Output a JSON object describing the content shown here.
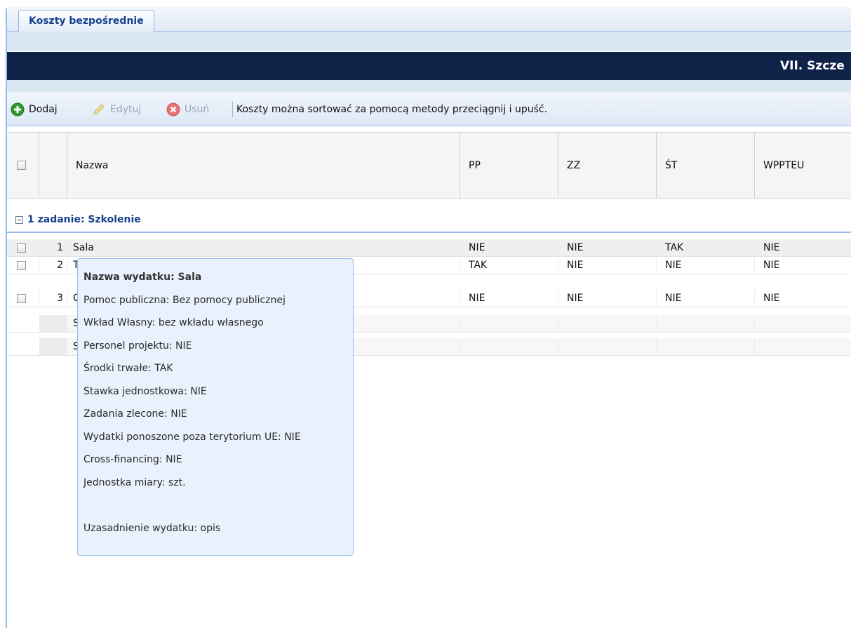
{
  "tabs": [
    {
      "label": "Koszty bezpośrednie"
    }
  ],
  "section_title": "VII. Szcze",
  "toolbar": {
    "add_label": "Dodaj",
    "edit_label": "Edytuj",
    "delete_label": "Usuń",
    "info": "Koszty można sortować za pomocą metody przeciągnij i upuść."
  },
  "columns": [
    "Nazwa",
    "PP",
    "ZZ",
    "ŚT",
    "WPPTEU"
  ],
  "group": {
    "label": "1 zadanie: Szkolenie"
  },
  "rows": [
    {
      "num": "1",
      "name": "Sala",
      "pp": "NIE",
      "zz": "NIE",
      "st": "TAK",
      "wppteu": "NIE"
    },
    {
      "num": "2",
      "name": "T",
      "pp": "TAK",
      "zz": "NIE",
      "st": "NIE",
      "wppteu": "NIE"
    },
    {
      "num": "3",
      "name": "C",
      "pp": "NIE",
      "zz": "NIE",
      "st": "NIE",
      "wppteu": "NIE"
    }
  ],
  "summary_rows": [
    {
      "label": "S"
    },
    {
      "label": "S"
    }
  ],
  "tooltip": {
    "title": "Nazwa wydatku: Sala",
    "lines": [
      "Pomoc publiczna: Bez pomocy publicznej",
      "Wkład Własny: bez wkładu własnego",
      "Personel projektu: NIE",
      "Środki trwałe: TAK",
      "Stawka jednostkowa: NIE",
      "Zadania zlecone: NIE",
      "Wydatki ponoszone poza terytorium UE: NIE",
      "Cross-financing: NIE",
      "Jednostka miary: szt."
    ],
    "footer": "Uzasadnienie wydatku: opis"
  },
  "colors": {
    "title_bar": "#0f2349",
    "tab_text": "#15428b",
    "group_text": "#15428b",
    "border_blue": "#99bbe8",
    "add_icon": "#2e9c2e",
    "delete_icon": "#e57373"
  }
}
